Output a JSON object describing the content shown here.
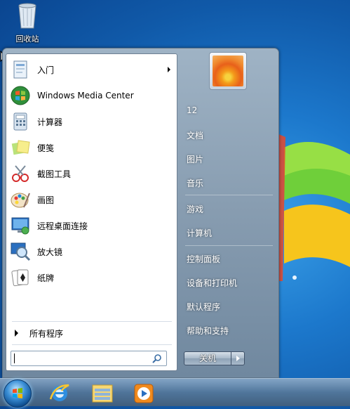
{
  "desktop": {
    "recycle_bin_label": "回收站",
    "recycle_bin_icon": "recycle-bin-icon"
  },
  "start_menu": {
    "programs": [
      {
        "label": "入门",
        "icon": "getting-started-icon",
        "has_submenu": true
      },
      {
        "label": "Windows Media Center",
        "icon": "media-center-icon",
        "has_submenu": false
      },
      {
        "label": "计算器",
        "icon": "calculator-icon",
        "has_submenu": false
      },
      {
        "label": "便笺",
        "icon": "sticky-notes-icon",
        "has_submenu": false
      },
      {
        "label": "截图工具",
        "icon": "snipping-tool-icon",
        "has_submenu": false
      },
      {
        "label": "画图",
        "icon": "paint-icon",
        "has_submenu": false
      },
      {
        "label": "远程桌面连接",
        "icon": "remote-desktop-icon",
        "has_submenu": false
      },
      {
        "label": "放大镜",
        "icon": "magnifier-icon",
        "has_submenu": false
      },
      {
        "label": "纸牌",
        "icon": "solitaire-icon",
        "has_submenu": false
      }
    ],
    "all_programs_label": "所有程序",
    "search": {
      "placeholder": "",
      "value": ""
    },
    "right_items": [
      {
        "label": "12"
      },
      {
        "label": "文档"
      },
      {
        "label": "图片"
      },
      {
        "label": "音乐"
      },
      {
        "label": "游戏"
      },
      {
        "label": "计算机"
      },
      {
        "label": "控制面板"
      },
      {
        "label": "设备和打印机"
      },
      {
        "label": "默认程序"
      },
      {
        "label": "帮助和支持"
      }
    ],
    "shutdown_label": "关机",
    "user_picture_icon": "flower-avatar-icon"
  },
  "taskbar": {
    "pinned": [
      {
        "icon": "internet-explorer-icon"
      },
      {
        "icon": "windows-explorer-icon"
      },
      {
        "icon": "media-player-icon"
      }
    ]
  }
}
